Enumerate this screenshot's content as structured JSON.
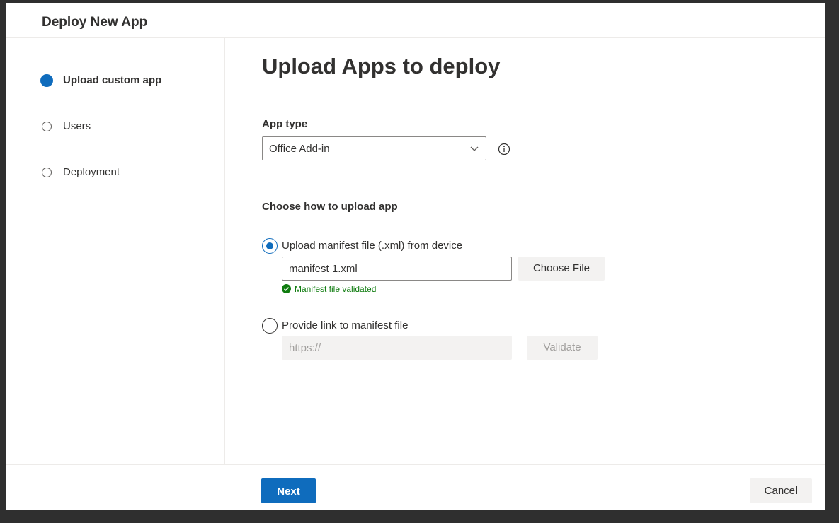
{
  "dialog": {
    "title": "Deploy New App"
  },
  "steps": [
    {
      "label": "Upload custom app",
      "state": "active"
    },
    {
      "label": "Users",
      "state": "pending"
    },
    {
      "label": "Deployment",
      "state": "pending"
    }
  ],
  "main": {
    "title": "Upload Apps to deploy",
    "app_type": {
      "label": "App type",
      "selected": "Office Add-in",
      "info_icon": "info-icon",
      "chevron_icon": "chevron-down-icon"
    },
    "upload": {
      "heading": "Choose how to upload app",
      "option_file": {
        "label": "Upload manifest file (.xml) from device",
        "checked": true,
        "value": "manifest 1.xml",
        "button": "Choose File",
        "status": "Manifest file validated",
        "status_icon": "checkmark-circle-icon"
      },
      "option_link": {
        "label": "Provide link to manifest file",
        "checked": false,
        "placeholder": "https://",
        "button": "Validate"
      }
    }
  },
  "footer": {
    "next_label": "Next",
    "cancel_label": "Cancel"
  },
  "colors": {
    "accent": "#0f6cbd",
    "success": "#107c10",
    "backdrop": "#2f2f2f"
  }
}
